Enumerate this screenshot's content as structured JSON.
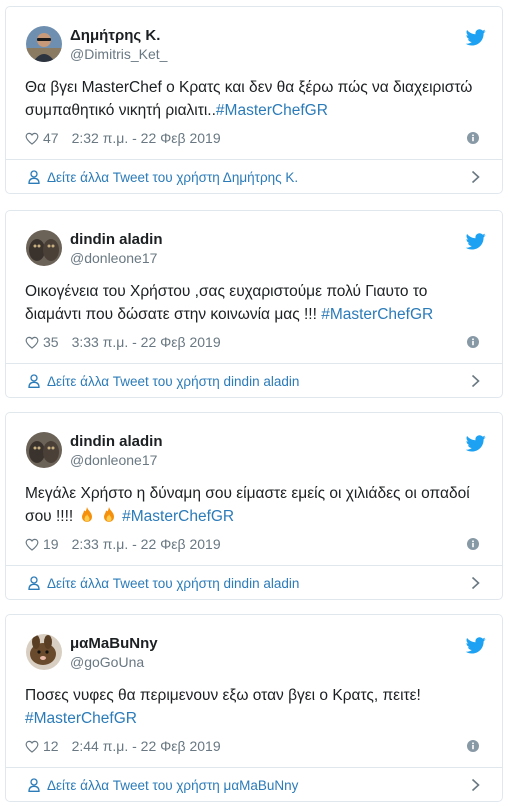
{
  "tweets": [
    {
      "name": "Δημήτρης Κ.",
      "handle": "@Dimitris_Ket_",
      "avatar": "profile-photo-man-sunglasses",
      "text": "Θα βγει MasterChef ο Κρατς και δεν θα ξέρω πώς να διαχειριστώ συμπαθητικό νικητή ριαλιτι..",
      "hashtag": "#MasterChefGR",
      "likes": "47",
      "time": "2:32 π.μ. - 22 Φεβ 2019",
      "more_label": "Δείτε άλλα Tweet του χρήστη Δημήτρης Κ."
    },
    {
      "name": "dindin aladin",
      "handle": "@donleone17",
      "avatar": "profile-photo-cats",
      "text": "Οικογένεια του Χρήστου ,σας ευχαριστούμε πολύ Γιαυτο το διαμάντι που δώσατε στην κοινωνία μας !!! ",
      "hashtag": "#MasterChefGR",
      "likes": "35",
      "time": "3:33 π.μ. - 22 Φεβ 2019",
      "more_label": "Δείτε άλλα Tweet του χρήστη dindin aladin"
    },
    {
      "name": "dindin aladin",
      "handle": "@donleone17",
      "avatar": "profile-photo-cats",
      "text_before": "Μεγάλε Χρήστο η δύναμη σου είμαστε εμείς οι χιλιάδες οι οπαδοί σου !!!! ",
      "emojis": [
        "fire-emoji",
        "fire-emoji"
      ],
      "hashtag": "#MasterChefGR",
      "likes": "19",
      "time": "2:33 π.μ. - 22 Φεβ 2019",
      "more_label": "Δείτε άλλα Tweet του χρήστη dindin aladin"
    },
    {
      "name": "μαMaBuNny",
      "handle": "@goGoUna",
      "avatar": "profile-photo-bunny",
      "text": "Ποσες νυφες θα περιμενουν εξω οταν βγει ο Κρατς, πειτε! ",
      "hashtag": "#MasterChefGR",
      "likes": "12",
      "time": "2:44 π.μ. - 22 Φεβ 2019",
      "more_label": "Δείτε άλλα Tweet του χρήστη μαMaBuNny"
    }
  ],
  "icons": {
    "twitter": "twitter-bird-icon",
    "heart": "heart-icon",
    "info": "info-icon",
    "person": "person-icon",
    "chevron": "chevron-right-icon"
  },
  "colors": {
    "brand": "#1da1f2",
    "link": "#2b7bb9",
    "secondary_text": "#697882",
    "border": "#e1e8ed",
    "text": "#1c2022"
  }
}
